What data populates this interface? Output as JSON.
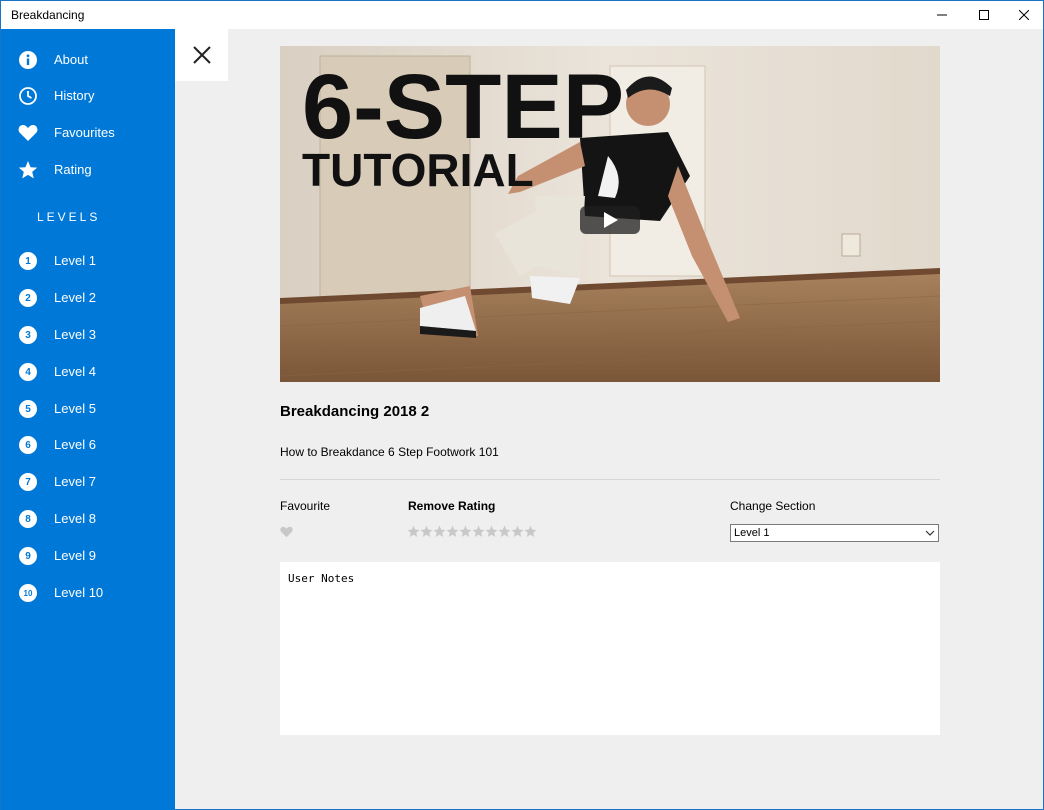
{
  "window": {
    "title": "Breakdancing",
    "controls": [
      "minimize-icon",
      "maximize-icon",
      "close-icon"
    ]
  },
  "sidebar": {
    "color": "#0078d7",
    "menu": [
      {
        "label": "About",
        "icon": "info-icon"
      },
      {
        "label": "History",
        "icon": "clock-icon"
      },
      {
        "label": "Favourites",
        "icon": "heart-icon"
      },
      {
        "label": "Rating",
        "icon": "star-icon"
      }
    ],
    "levels_header": "LEVELS",
    "levels": [
      {
        "num": "1",
        "label": "Level 1"
      },
      {
        "num": "2",
        "label": "Level 2"
      },
      {
        "num": "3",
        "label": "Level 3"
      },
      {
        "num": "4",
        "label": "Level 4"
      },
      {
        "num": "5",
        "label": "Level 5"
      },
      {
        "num": "6",
        "label": "Level 6"
      },
      {
        "num": "7",
        "label": "Level 7"
      },
      {
        "num": "8",
        "label": "Level 8"
      },
      {
        "num": "9",
        "label": "Level 9"
      },
      {
        "num": "10",
        "label": "Level 10"
      }
    ]
  },
  "pane": {
    "close_icon": "close-x-icon"
  },
  "video": {
    "thumbnail_text_line1": "6-STEP",
    "thumbnail_text_line2": "TUTORIAL",
    "play_icon": "play-icon"
  },
  "detail": {
    "title": "Breakdancing 2018 2",
    "description": "How to Breakdance 6 Step Footwork 101",
    "favourite_label": "Favourite",
    "rating_label": "Remove Rating",
    "rating_value": 0,
    "rating_max": 10,
    "section_label": "Change Section",
    "section_selected": "Level 1",
    "notes_placeholder": "User Notes"
  }
}
